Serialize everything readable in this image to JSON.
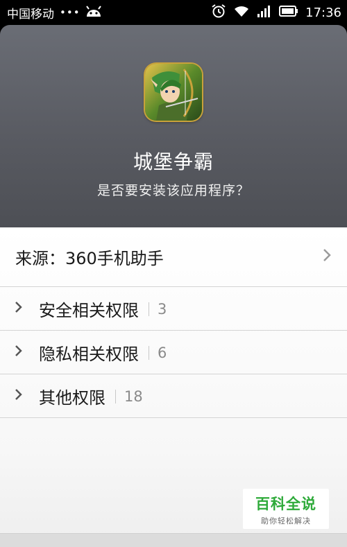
{
  "status_bar": {
    "carrier": "中国移动",
    "dots": "•••",
    "time": "17:36"
  },
  "header": {
    "app_name": "城堡争霸",
    "question": "是否要安装该应用程序？"
  },
  "source": {
    "label": "来源：360手机助手"
  },
  "permissions": [
    {
      "label": "安全相关权限",
      "count": "3"
    },
    {
      "label": "隐私相关权限",
      "count": "6"
    },
    {
      "label": "其他权限",
      "count": "18"
    }
  ],
  "watermark": {
    "title": "百科全说",
    "subtitle": "助你轻松解决"
  }
}
